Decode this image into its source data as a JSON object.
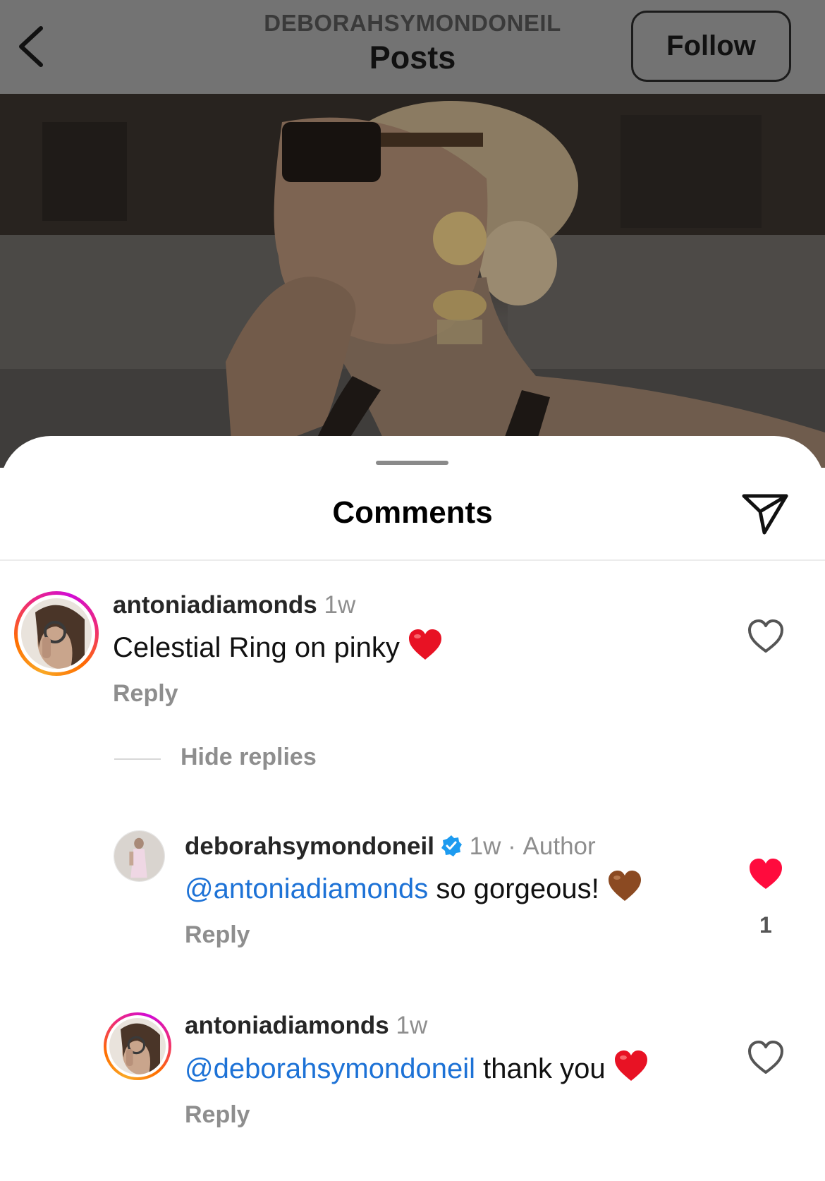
{
  "header": {
    "account_label": "DEBORAHSYMONDONEIL",
    "title": "Posts",
    "follow_label": "Follow"
  },
  "sheet": {
    "title": "Comments",
    "hide_replies_label": "Hide replies"
  },
  "comments": [
    {
      "username": "antoniadiamonds",
      "time": "1w",
      "text": "Celestial Ring on pinky",
      "emoji": "red-heart",
      "reply_label": "Reply",
      "liked": false
    },
    {
      "username": "deborahsymondoneil",
      "verified": true,
      "time": "1w",
      "separator": "·",
      "author_tag": "Author",
      "mention": "@antoniadiamonds",
      "text": "so gorgeous!",
      "emoji": "brown-heart",
      "reply_label": "Reply",
      "liked": true,
      "like_count": "1"
    },
    {
      "username": "antoniadiamonds",
      "time": "1w",
      "mention": "@deborahsymondoneil",
      "text": "thank you",
      "emoji": "red-heart",
      "reply_label": "Reply",
      "liked": false
    }
  ],
  "colors": {
    "mention": "#1d72d6",
    "like_red": "#ff0b3d",
    "muted_text": "#8e8e8e"
  },
  "icons": [
    "back-chevron-icon",
    "share-send-icon",
    "heart-outline-icon",
    "heart-filled-icon",
    "verified-badge-icon"
  ]
}
